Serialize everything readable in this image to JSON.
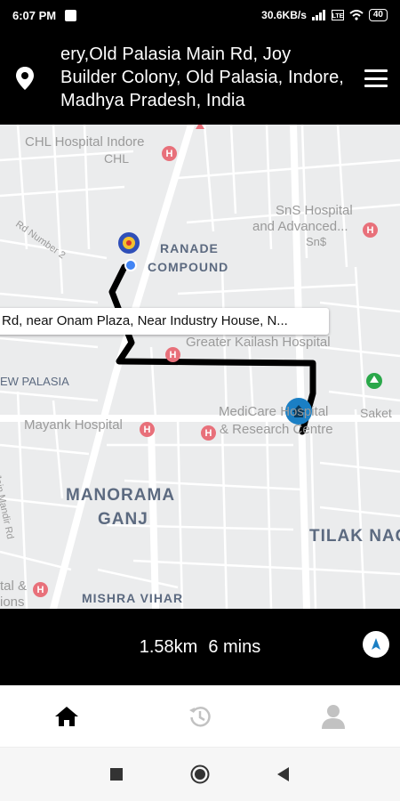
{
  "status_bar": {
    "time": "6:07 PM",
    "network_speed": "30.6KB/s",
    "battery": "40"
  },
  "header": {
    "address": "ery,Old Palasia Main Rd, Joy Builder Colony, Old Palasia, Indore, Madhya Pradesh, India",
    "icons": [
      "location-pin-icon",
      "hamburger-menu-icon"
    ]
  },
  "map": {
    "callout_text": "Rd, near Onam Plaza, Near Industry House, N...",
    "labels": {
      "chl_hospital": "CHL Hospital Indore",
      "chl": "CHL",
      "sns_hospital": "SnS Hospital",
      "and_advanced": "and Advanced...",
      "sns": "Sn$",
      "ranade": "RANADE",
      "compound": "COMPOUND",
      "greater_kailash": "Greater Kailash Hospital",
      "new_palasia": "EW PALASIA",
      "saket": "Saket",
      "mayank": "Mayank Hospital",
      "medicare_1": "MediCare Hospital",
      "medicare_2": "& Research Centre",
      "manorama": "MANORAMA",
      "ganj": "GANJ",
      "tilak": "TILAK NAG",
      "mishra": "MISHRA VIHAR",
      "tal": "tal &",
      "ions": "ions",
      "rd_number": "Rd Number 2",
      "jain_mandir": "Jain Mandir Rd"
    }
  },
  "trip": {
    "distance": "1.58km",
    "duration": "6 mins"
  },
  "tabs": [
    {
      "icon": "home-icon"
    },
    {
      "icon": "history-icon"
    },
    {
      "icon": "profile-icon"
    }
  ],
  "colors": {
    "bar_bg": "#000000",
    "map_bg": "#ebeced",
    "route": "#000000",
    "hospital_pin": "#e8707a",
    "destination_pin": "#1b7fc4",
    "area_label": "#5c6a80"
  }
}
